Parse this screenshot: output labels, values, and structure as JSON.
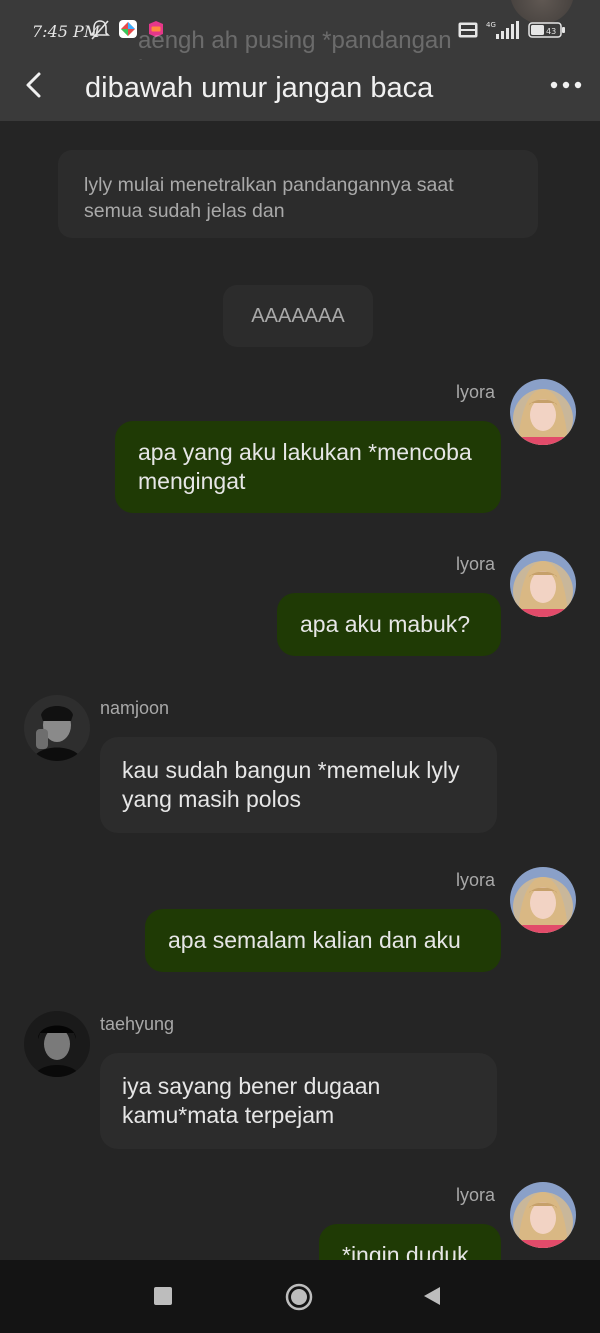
{
  "status_bar": {
    "time": "7:45 PM",
    "left_icons": [
      "muted-bell-icon",
      "colorful-app-icon",
      "lazada-app-icon"
    ],
    "right_icons": [
      "volte-icon",
      "signal-4g-icon",
      "battery-icon"
    ],
    "battery": "43",
    "network": "4G"
  },
  "ghost_overlay": {
    "text": "aengh ah pusing *pandangan buram"
  },
  "header": {
    "title": "dibawah umur jangan baca"
  },
  "chat": {
    "narration": "lyly mulai menetralkan pandangannya saat semua sudah jelas dan",
    "center_message": "AAAAAAA",
    "messages": [
      {
        "sender": "lyora",
        "side": "right",
        "text": "apa yang aku lakukan *mencoba mengingat"
      },
      {
        "sender": "lyora",
        "side": "right",
        "text": "apa aku mabuk?"
      },
      {
        "sender": "namjoon",
        "side": "left",
        "text": "kau sudah bangun *memeluk lyly yang masih polos"
      },
      {
        "sender": "lyora",
        "side": "right",
        "text": "apa semalam kalian dan aku"
      },
      {
        "sender": "taehyung",
        "side": "left",
        "text": "iya sayang bener dugaan kamu*mata terpejam"
      },
      {
        "sender": "lyora",
        "side": "right",
        "text": "*ingin duduk"
      }
    ]
  },
  "colors": {
    "background": "#252525",
    "header": "#3a3a3a",
    "outgoing_bubble": "#1f3a05",
    "incoming_bubble": "#2c2c2c",
    "navbar": "#141414"
  },
  "navbar": {
    "icons": [
      "recents-square-icon",
      "home-circle-icon",
      "back-triangle-icon"
    ]
  }
}
